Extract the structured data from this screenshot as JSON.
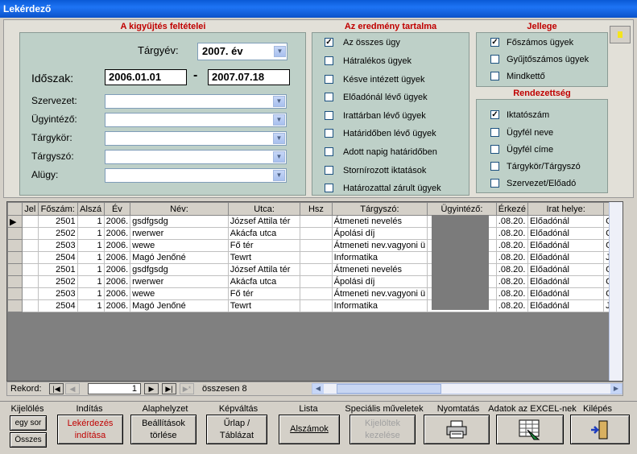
{
  "window": {
    "title": "Lekérdező"
  },
  "criteria": {
    "title": "A kigyűjtés feltételei",
    "targyev_label": "Tárgyév:",
    "targyev_value": "2007. év",
    "idoszak_label": "Időszak:",
    "date_from": "2006.01.01",
    "dash": "-",
    "date_to": "2007.07.18",
    "fields": [
      "Szervezet:",
      "Ügyintéző:",
      "Tárgykör:",
      "Tárgyszó:",
      "Alügy:"
    ]
  },
  "results": {
    "title": "Az eredmény tartalma",
    "items": [
      {
        "label": "Az összes ügy",
        "checked": true
      },
      {
        "label": "Hátralékos ügyek",
        "checked": false
      },
      {
        "label": "Késve intézett ügyek",
        "checked": false
      },
      {
        "label": "Előadónál lévő ügyek",
        "checked": false
      },
      {
        "label": "Irattárban lévő ügyek",
        "checked": false
      },
      {
        "label": "Határidőben lévő ügyek",
        "checked": false
      },
      {
        "label": "Adott napig határidőben",
        "checked": false
      },
      {
        "label": "Stornírozott iktatások",
        "checked": false
      },
      {
        "label": "Határozattal zárult ügyek",
        "checked": false
      }
    ]
  },
  "jellege": {
    "title": "Jellege",
    "items": [
      {
        "label": "Főszámos ügyek",
        "checked": true
      },
      {
        "label": "Gyűjtőszámos ügyek",
        "checked": false
      },
      {
        "label": "Mindkettő",
        "checked": false
      }
    ]
  },
  "rendezettseg": {
    "title": "Rendezettség",
    "items": [
      {
        "label": "Iktatószám",
        "checked": true
      },
      {
        "label": "Ügyfél neve",
        "checked": false
      },
      {
        "label": "Ügyfél címe",
        "checked": false
      },
      {
        "label": "Tárgykör/Tárgyszó",
        "checked": false
      },
      {
        "label": "Szervezet/Előadó",
        "checked": false
      }
    ]
  },
  "table": {
    "columns": [
      "",
      "Jel",
      "Főszám:",
      "Alszá",
      "Év",
      "Név:",
      "Utca:",
      "Hsz",
      "Tárgyszó:",
      "Ügyintéző:",
      "Érkezé",
      "Irat helye:",
      ""
    ],
    "rows": [
      [
        "▶",
        "",
        "2501",
        "1",
        "2006.",
        "gsdfgsdg",
        "József Attila tér",
        "",
        "Átmeneti nevelés",
        "",
        ".08.20.",
        "Előadónál",
        "Gy"
      ],
      [
        "",
        "",
        "2502",
        "1",
        "2006.",
        "rwerwer",
        "Akácfa utca",
        "",
        "Ápolási díj",
        "",
        ".08.20.",
        "Előadónál",
        "Cs"
      ],
      [
        "",
        "",
        "2503",
        "1",
        "2006.",
        "wewe",
        "Fő tér",
        "",
        "Átmeneti nev.vagyoni ü",
        "",
        ".08.20.",
        "Előadónál",
        "Gy"
      ],
      [
        "",
        "",
        "2504",
        "1",
        "2006.",
        "Magó Jenőné",
        "Tewrt",
        "",
        "Informatika",
        "",
        ".08.20.",
        "Előadónál",
        "Jeg"
      ],
      [
        "",
        "",
        "2501",
        "1",
        "2006.",
        "gsdfgsdg",
        "József Attila tér",
        "",
        "Átmeneti nevelés",
        "",
        ".08.20.",
        "Előadónál",
        "Gy"
      ],
      [
        "",
        "",
        "2502",
        "1",
        "2006.",
        "rwerwer",
        "Akácfa utca",
        "",
        "Ápolási díj",
        "",
        ".08.20.",
        "Előadónál",
        "Cs"
      ],
      [
        "",
        "",
        "2503",
        "1",
        "2006.",
        "wewe",
        "Fő tér",
        "",
        "Átmeneti nev.vagyoni ü",
        "",
        ".08.20.",
        "Előadónál",
        "Gy"
      ],
      [
        "",
        "",
        "2504",
        "1",
        "2006.",
        "Magó Jenőné",
        "Tewrt",
        "",
        "Informatika",
        "",
        ".08.20.",
        "Előadónál",
        "Jeg"
      ]
    ]
  },
  "nav": {
    "label": "Rekord:",
    "current": "1",
    "total_label": "összesen  8"
  },
  "toolbar": {
    "labels": [
      "Kijelölés",
      "Indítás",
      "Alaphelyzet",
      "Képváltás",
      "Lista",
      "Speciális műveletek",
      "Nyomtatás",
      "Adatok az EXCEL-nek",
      "Kilépés"
    ],
    "egy_sor": "egy sor",
    "osszes": "Összes",
    "lekerdezes": "Lekérdezés indítása",
    "beallitasok": "Beállítások törlése",
    "urlap": "Űrlap / Táblázat",
    "alszamok": "Alszámok",
    "kijeloltek": "Kijelöltek kezelése"
  }
}
